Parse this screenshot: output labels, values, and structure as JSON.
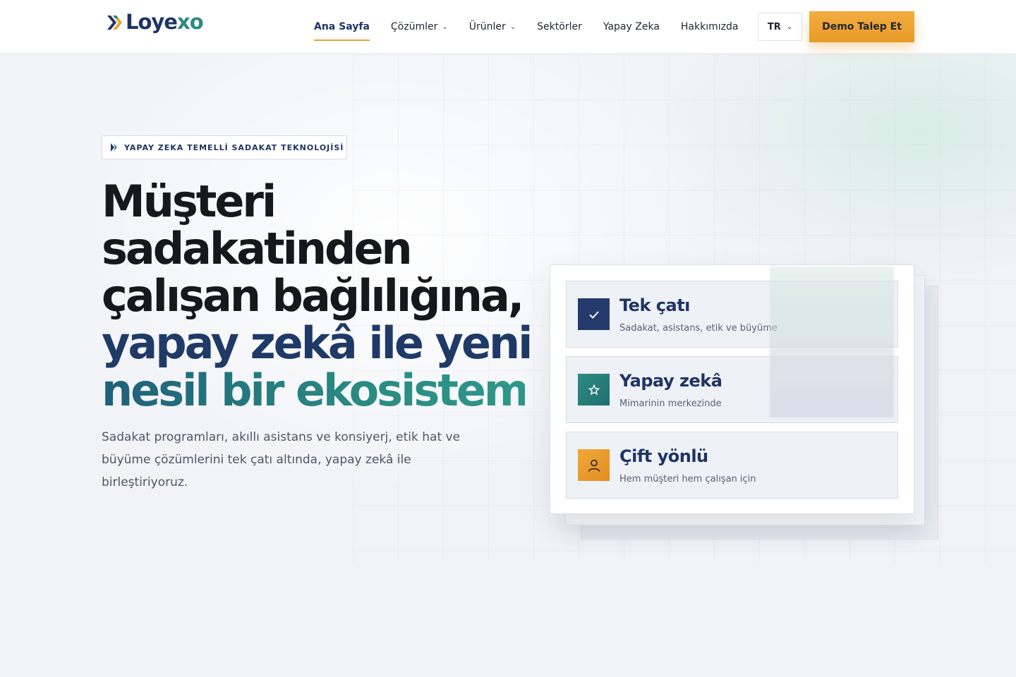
{
  "brand": {
    "name_main": "Loye",
    "name_accent": "xo",
    "primary_color": "#1f3463",
    "accent_color": "#2b8a84",
    "cta_color": "#e89b27"
  },
  "nav": {
    "items": [
      {
        "label": "Ana Sayfa",
        "active": true,
        "dropdown": false
      },
      {
        "label": "Çözümler",
        "active": false,
        "dropdown": true
      },
      {
        "label": "Ürünler",
        "active": false,
        "dropdown": true
      },
      {
        "label": "Sektörler",
        "active": false,
        "dropdown": false
      },
      {
        "label": "Yapay Zeka",
        "active": false,
        "dropdown": false
      },
      {
        "label": "Hakkımızda",
        "active": false,
        "dropdown": false
      }
    ],
    "language": "TR",
    "cta_label": "Demo Talep Et"
  },
  "hero": {
    "badge": "YAPAY ZEKA TEMELLİ SADAKAT TEKNOLOJİSİ",
    "headline": {
      "line1": "Müşteri",
      "line2": "sadakatinden",
      "line3": "çalışan bağlılığına,",
      "line4": "yapay zekâ ile yeni",
      "line5": "nesil bir ekosistem."
    },
    "lead": "Sadakat programları, akıllı asistans ve konsiyerj, etik hat ve büyüme çözümlerini tek çatı altında, yapay zekâ ile birleştiriyoruz."
  },
  "features": [
    {
      "title": "Tek çatı",
      "subtitle": "Sadakat, asistans, etik ve büyüme",
      "icon": "check-icon"
    },
    {
      "title": "Yapay zekâ",
      "subtitle": "Mimarinin merkezinde",
      "icon": "star-icon"
    },
    {
      "title": "Çift yönlü",
      "subtitle": "Hem müşteri hem çalışan için",
      "icon": "user-icon"
    }
  ]
}
